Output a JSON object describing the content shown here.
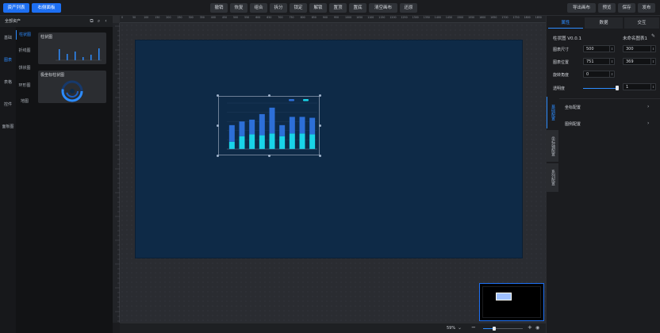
{
  "topbar": {
    "asset_list": "资产列表",
    "layer_panel": "右侧面板",
    "tools": [
      "撤销",
      "恢复",
      "组合",
      "拆分",
      "锁定",
      "解锁",
      "置顶",
      "置底",
      "清空画布",
      "还原"
    ],
    "export": "导出画布",
    "preview": "预览",
    "save": "保存",
    "publish": "发布"
  },
  "left": {
    "header": "全部资产",
    "categories": [
      "基础",
      "图表",
      "表格",
      "控件",
      "面板图"
    ],
    "subcategories": [
      "柱状图",
      "折线图",
      "饼状图",
      "环形图",
      "地图"
    ],
    "cards": [
      {
        "title": "柱状图"
      },
      {
        "title": "极坐标柱状图"
      }
    ]
  },
  "ruler": {
    "ticks": [
      "0",
      "50",
      "100",
      "150",
      "200",
      "250",
      "300",
      "350",
      "400",
      "450",
      "500",
      "550",
      "600",
      "650",
      "700",
      "750",
      "800",
      "850",
      "900",
      "950",
      "1000",
      "1050",
      "1100",
      "1150",
      "1200",
      "1250",
      "1300",
      "1350",
      "1400",
      "1450",
      "1500",
      "1550",
      "1600",
      "1650",
      "1700",
      "1750",
      "1800",
      "1850",
      "1900",
      "1950"
    ]
  },
  "bottom": {
    "zoom": "59%"
  },
  "right": {
    "tabs": [
      "属性",
      "数据",
      "交互"
    ],
    "component_name": "柱状图 V0.0.1",
    "component_alias": "未命名图表1",
    "size_label": "图表尺寸",
    "width": "500",
    "height": "300",
    "pos_label": "图表位置",
    "x": "751",
    "y": "369",
    "rotate_label": "旋转角度",
    "rotate": "0",
    "opacity_label": "透明度",
    "opacity": "1",
    "opacity_level": 1,
    "sections": [
      "坐标配置",
      "图例配置"
    ],
    "side_tabs": [
      "基础配置",
      "坐标轴配置",
      "系列配置"
    ]
  },
  "colors": {
    "accent": "#1d6ff2",
    "canvas": "#0e2a47",
    "bar_top": "#2d6fd8",
    "bar_bottom": "#19d4e8"
  },
  "chart_data": {
    "type": "bar",
    "categories": [
      "",
      "",
      "",
      "",
      "",
      "",
      "",
      "",
      ""
    ],
    "series": [
      {
        "name": "",
        "values": [
          18,
          16,
          16,
          23,
          28,
          12,
          18,
          18,
          18
        ]
      },
      {
        "name": "",
        "values": [
          8,
          14,
          16,
          15,
          17,
          14,
          17,
          17,
          16
        ]
      }
    ],
    "stacked": true,
    "ylim": [
      0,
      50
    ],
    "grid": true,
    "legend": "top-right"
  }
}
